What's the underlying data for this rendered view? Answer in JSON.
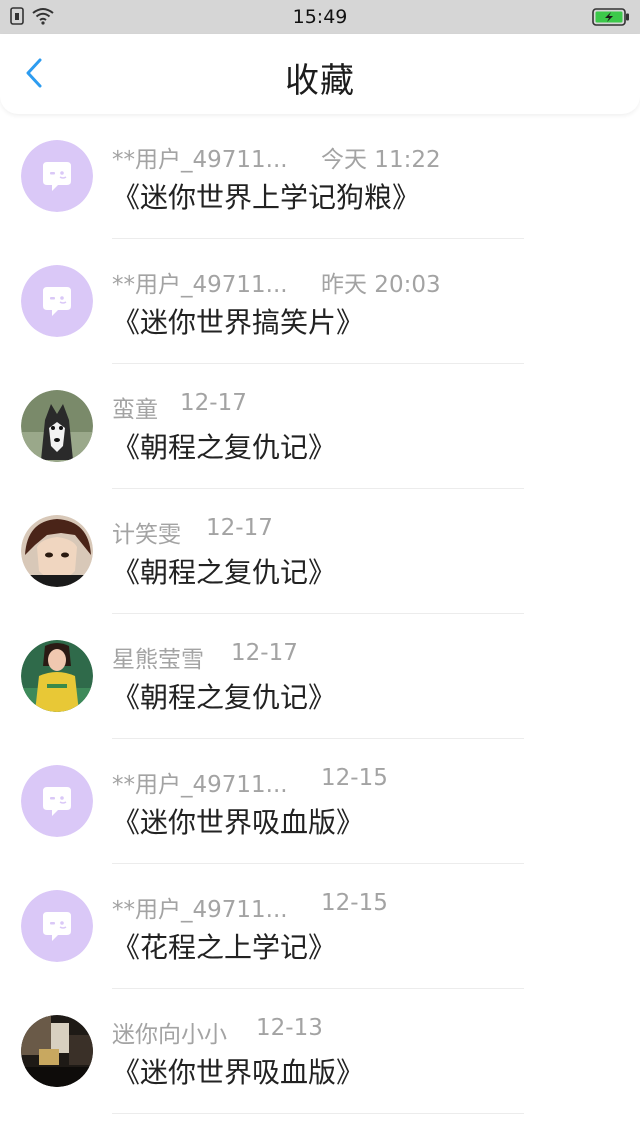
{
  "status_bar": {
    "time": "15:49"
  },
  "header": {
    "title": "收藏"
  },
  "items": [
    {
      "user": "**用户_49711...",
      "date": "今天 11:22",
      "book": "《迷你世界上学记狗粮》",
      "avatar": "default-chat-avatar"
    },
    {
      "user": "**用户_49711...",
      "date": "昨天 20:03",
      "book": "《迷你世界搞笑片》",
      "avatar": "default-chat-avatar"
    },
    {
      "user": "蛮童",
      "date": "12-17",
      "book": "《朝程之复仇记》",
      "avatar": "husky-dog-photo"
    },
    {
      "user": "计笑雯",
      "date": "12-17",
      "book": "《朝程之复仇记》",
      "avatar": "anime-boy-photo"
    },
    {
      "user": "星熊莹雪",
      "date": "12-17",
      "book": "《朝程之复仇记》",
      "avatar": "girl-stadium-photo"
    },
    {
      "user": "**用户_49711...",
      "date": "12-15",
      "book": "《迷你世界吸血版》",
      "avatar": "default-chat-avatar"
    },
    {
      "user": "**用户_49711...",
      "date": "12-15",
      "book": "《花程之上学记》",
      "avatar": "default-chat-avatar"
    },
    {
      "user": "迷你向小小",
      "date": "12-13",
      "book": "《迷你世界吸血版》",
      "avatar": "dark-photo"
    }
  ],
  "colors": {
    "accent": "#2d9cf0",
    "default_avatar": "#dac8f7",
    "meta_text": "#a3a3a3"
  }
}
